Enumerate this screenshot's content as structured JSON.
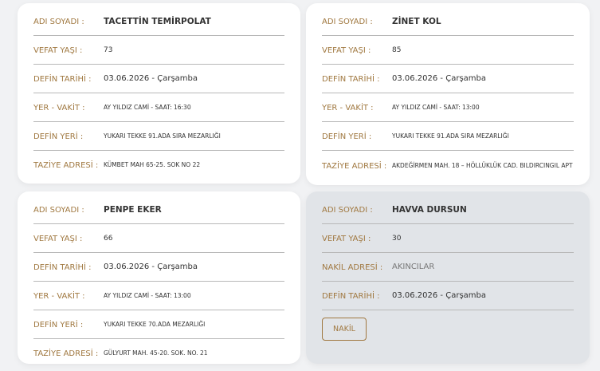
{
  "labels": {
    "name": "ADI SOYADI :",
    "age": "VEFAT YAŞI :",
    "date": "DEFİN TARİHİ :",
    "time": "YER - VAKİT :",
    "place": "DEFİN YERİ :",
    "condolence": "TAZİYE ADRESİ :",
    "transfer": "NAKİL ADRESİ :"
  },
  "cards": [
    {
      "name": "TACETTİN TEMİRPOLAT",
      "age": "73",
      "date": "03.06.2026 - Çarşamba",
      "time": "AY YILDIZ CAMİ - SAAT: 16:30",
      "place": "YUKARI TEKKE 91.ADA SIRA MEZARLIĞI",
      "condolence": "KÜMBET MAH 65-25. SOK NO 22"
    },
    {
      "name": "ZİNET KOL",
      "age": "85",
      "date": "03.06.2026 - Çarşamba",
      "time": "AY YILDIZ CAMİ - SAAT: 13:00",
      "place": "YUKARI TEKKE 91.ADA SIRA MEZARLIĞI",
      "condolence": "AKDEĞİRMEN MAH. 18 – HÖLLÜKLÜK CAD. BILDIRCINGIL APT"
    },
    {
      "name": "PENPE EKER",
      "age": "66",
      "date": "03.06.2026 - Çarşamba",
      "time": "AY YILDIZ CAMİ - SAAT: 13:00",
      "place": "YUKARI TEKKE 70.ADA MEZARLIĞI",
      "condolence": "GÜLYURT MAH. 45-20. SOK. NO. 21"
    },
    {
      "name": "HAVVA DURSUN",
      "age": "30",
      "transfer": "AKINCILAR",
      "date": "03.06.2026 - Çarşamba",
      "button": "NAKİL"
    }
  ],
  "colors": {
    "label": "#a07840",
    "card": "#ffffff",
    "card_transfer": "#e1e4e8"
  }
}
